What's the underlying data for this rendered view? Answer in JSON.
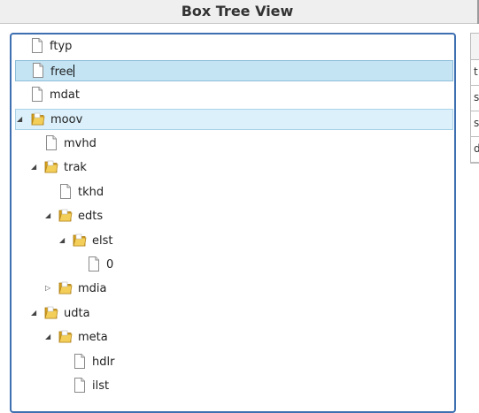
{
  "header": {
    "title": "Box Tree View"
  },
  "tree": {
    "nodes": [
      {
        "label": "ftyp",
        "type": "file",
        "toggle": ""
      },
      {
        "label": "free",
        "type": "file",
        "toggle": "",
        "editing": true
      },
      {
        "label": "mdat",
        "type": "file",
        "toggle": ""
      },
      {
        "label": "moov",
        "type": "folder",
        "toggle": "◢"
      },
      {
        "label": "mvhd",
        "type": "file",
        "toggle": ""
      },
      {
        "label": "trak",
        "type": "folder",
        "toggle": "◢"
      },
      {
        "label": "tkhd",
        "type": "file",
        "toggle": ""
      },
      {
        "label": "edts",
        "type": "folder",
        "toggle": "◢"
      },
      {
        "label": "elst",
        "type": "folder",
        "toggle": "◢"
      },
      {
        "label": "0",
        "type": "file",
        "toggle": ""
      },
      {
        "label": "mdia",
        "type": "folder",
        "toggle": "▷"
      },
      {
        "label": "udta",
        "type": "folder",
        "toggle": "◢"
      },
      {
        "label": "meta",
        "type": "folder",
        "toggle": "◢"
      },
      {
        "label": "hdlr",
        "type": "file",
        "toggle": ""
      },
      {
        "label": "ilst",
        "type": "file",
        "toggle": ""
      }
    ]
  },
  "side_table": {
    "cells": [
      "",
      "t",
      "s",
      "s",
      "d"
    ]
  }
}
